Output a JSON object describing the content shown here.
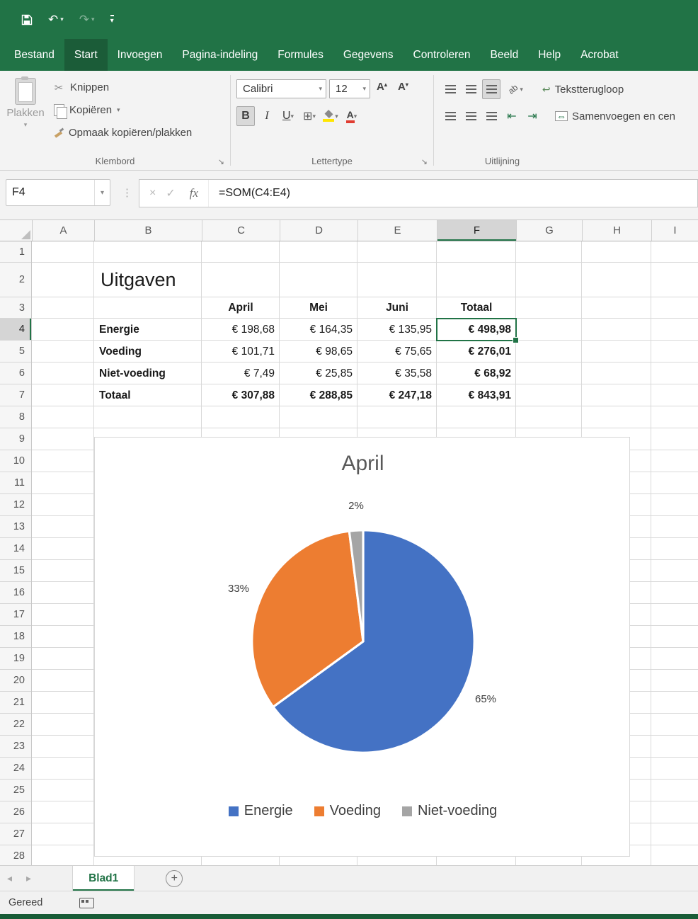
{
  "icons": {
    "caret_down": "▾",
    "caret_up": "▴",
    "launcher": "↘",
    "scissors": "✂",
    "undo": "↶",
    "redo": "↷",
    "close": "×",
    "check": "✓",
    "dots": "⋮",
    "borders_grid": "⊞",
    "indent_left": "⇤",
    "indent_right": "⇥",
    "prev_arrow": "◂",
    "next_arrow": "▸",
    "plus": "+",
    "wrap_return": "↩",
    "merge_arrows": "⇔",
    "orientation_text": "ab"
  },
  "tabs": [
    {
      "label": "Bestand",
      "active": false
    },
    {
      "label": "Start",
      "active": true
    },
    {
      "label": "Invoegen",
      "active": false
    },
    {
      "label": "Pagina-indeling",
      "active": false
    },
    {
      "label": "Formules",
      "active": false
    },
    {
      "label": "Gegevens",
      "active": false
    },
    {
      "label": "Controleren",
      "active": false
    },
    {
      "label": "Beeld",
      "active": false
    },
    {
      "label": "Help",
      "active": false
    },
    {
      "label": "Acrobat",
      "active": false
    }
  ],
  "ribbon": {
    "clipboard": {
      "label": "Klembord",
      "paste": "Plakken",
      "cut": "Knippen",
      "copy": "Kopiëren",
      "format_painter": "Opmaak kopiëren/plakken"
    },
    "font": {
      "label": "Lettertype",
      "font_name": "Calibri",
      "font_size": "12",
      "bold": "B",
      "italic": "I",
      "underline": "U",
      "grow_shrink_letter": "A",
      "font_color_letter": "A"
    },
    "alignment": {
      "label": "Uitlijning",
      "wrap_text": "Tekstterugloop",
      "merge_center": "Samenvoegen en cen"
    }
  },
  "formula_bar": {
    "name_box": "F4",
    "fx_label": "fx",
    "formula": "=SOM(C4:E4)"
  },
  "sheet": {
    "columns": [
      "A",
      "B",
      "C",
      "D",
      "E",
      "F",
      "G",
      "H",
      "I"
    ],
    "row_numbers": [
      1,
      2,
      3,
      4,
      5,
      6,
      7,
      8,
      9,
      10,
      11,
      12,
      13,
      14,
      15,
      16,
      17,
      18,
      19,
      20,
      21,
      22,
      23,
      24,
      25,
      26,
      27,
      28
    ],
    "selected": {
      "col": "F",
      "row": 4
    },
    "cells": [
      {
        "ref": "B2",
        "text": "Uitgaven",
        "style": "title"
      },
      {
        "ref": "C3",
        "text": "April",
        "style": "colhead"
      },
      {
        "ref": "D3",
        "text": "Mei",
        "style": "colhead"
      },
      {
        "ref": "E3",
        "text": "Juni",
        "style": "colhead"
      },
      {
        "ref": "F3",
        "text": "Totaal",
        "style": "colhead"
      },
      {
        "ref": "B4",
        "text": "Energie",
        "style": "rowlabel"
      },
      {
        "ref": "C4",
        "text": "€ 198,68",
        "style": "num"
      },
      {
        "ref": "D4",
        "text": "€ 164,35",
        "style": "num"
      },
      {
        "ref": "E4",
        "text": "€ 135,95",
        "style": "num"
      },
      {
        "ref": "F4",
        "text": "€ 498,98",
        "style": "numbold"
      },
      {
        "ref": "B5",
        "text": "Voeding",
        "style": "rowlabel"
      },
      {
        "ref": "C5",
        "text": "€ 101,71",
        "style": "num"
      },
      {
        "ref": "D5",
        "text": "€ 98,65",
        "style": "num"
      },
      {
        "ref": "E5",
        "text": "€ 75,65",
        "style": "num"
      },
      {
        "ref": "F5",
        "text": "€ 276,01",
        "style": "numbold"
      },
      {
        "ref": "B6",
        "text": "Niet-voeding",
        "style": "rowlabel"
      },
      {
        "ref": "C6",
        "text": "€ 7,49",
        "style": "num"
      },
      {
        "ref": "D6",
        "text": "€ 25,85",
        "style": "num"
      },
      {
        "ref": "E6",
        "text": "€ 35,58",
        "style": "num"
      },
      {
        "ref": "F6",
        "text": "€ 68,92",
        "style": "numbold"
      },
      {
        "ref": "B7",
        "text": "Totaal",
        "style": "rowlabel"
      },
      {
        "ref": "C7",
        "text": "€ 307,88",
        "style": "numbold"
      },
      {
        "ref": "D7",
        "text": "€ 288,85",
        "style": "numbold"
      },
      {
        "ref": "E7",
        "text": "€ 247,18",
        "style": "numbold"
      },
      {
        "ref": "F7",
        "text": "€ 843,91",
        "style": "numbold"
      }
    ]
  },
  "chart_data": {
    "type": "pie",
    "title": "April",
    "labels": [
      "Energie",
      "Voeding",
      "Niet-voeding"
    ],
    "values": [
      65,
      33,
      2
    ],
    "percent_labels": [
      "65%",
      "33%",
      "2%"
    ],
    "colors": [
      "#4472c4",
      "#ed7d31",
      "#a5a5a5"
    ],
    "legend_position": "bottom"
  },
  "sheet_tabs": {
    "active_tab": "Blad1"
  },
  "status_bar": {
    "text": "Gereed"
  }
}
